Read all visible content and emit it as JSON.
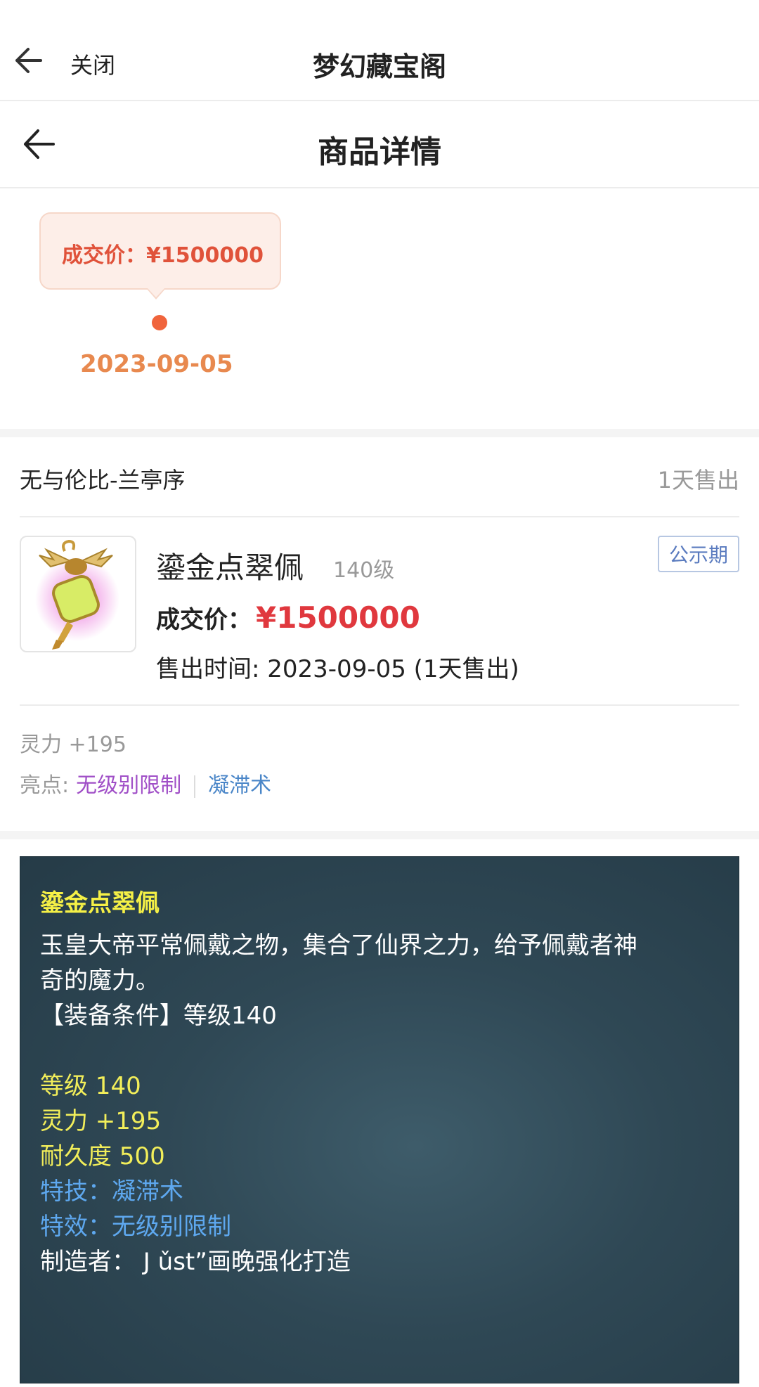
{
  "header": {
    "close_label": "关闭",
    "app_title": "梦幻藏宝阁",
    "page_title": "商品详情"
  },
  "history": {
    "bubble_text": "成交价：¥1500000",
    "date": "2023-09-05"
  },
  "listing": {
    "series_name": "无与伦比-兰亭序",
    "sold_days": "1天售出",
    "item_name": "鎏金点翠佩",
    "item_level": "140级",
    "tag": "公示期",
    "price_label": "成交价：",
    "price_value": "¥1500000",
    "sale_time": "售出时间: 2023-09-05 (1天售出)",
    "attribute": "灵力 +195",
    "highlights_label": "亮点:",
    "highlight_1": "无级别限制",
    "highlight_2": "凝滞术"
  },
  "tooltip": {
    "title": "鎏金点翠佩",
    "desc_line1": "玉皇大帝平常佩戴之物，集合了仙界之力，给予佩戴者神",
    "desc_line2": "奇的魔力。",
    "requirement": "【装备条件】等级140",
    "level": "等级 140",
    "spirit": "灵力 +195",
    "durability": "耐久度 500",
    "skill": "特技：凝滞术",
    "effect": "特效：无级别限制",
    "maker": "制造者： J ǔst”画晚强化打造"
  },
  "colors": {
    "price_red": "#e0383e",
    "bubble_text": "#e0523a",
    "date_orange": "#e8894f",
    "tag_blue": "#5a7bbf",
    "highlight_purple": "#a04fc7",
    "highlight_blue": "#4a86c8",
    "tooltip_yellow": "#f2ee5a",
    "tooltip_blue": "#5ea8ef"
  },
  "icons": {
    "back": "arrow-left-icon",
    "item_image": "jade-pendant-icon"
  }
}
